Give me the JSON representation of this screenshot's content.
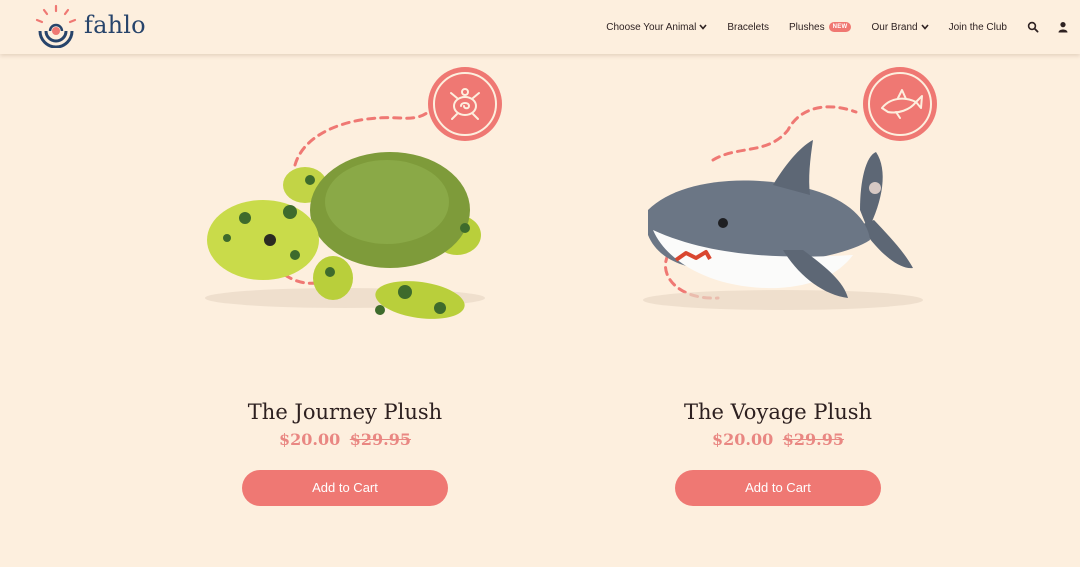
{
  "brand": {
    "name": "fahlo"
  },
  "nav": {
    "items": [
      {
        "label": "Choose Your Animal",
        "dropdown": true
      },
      {
        "label": "Bracelets",
        "dropdown": false
      },
      {
        "label": "Plushes",
        "badge": "NEW"
      },
      {
        "label": "Our Brand",
        "dropdown": true
      },
      {
        "label": "Join the Club",
        "dropdown": false
      }
    ],
    "search_icon": "search-icon",
    "account_icon": "user-icon"
  },
  "colors": {
    "background": "#fdefde",
    "accent": "#ef7873",
    "brand_navy": "#27446b",
    "price": "#e98782"
  },
  "products": [
    {
      "title": "The Journey Plush",
      "price": "$20.00",
      "original_price": "$29.95",
      "button": "Add to Cart",
      "animal_icon": "turtle-icon"
    },
    {
      "title": "The Voyage Plush",
      "price": "$20.00",
      "original_price": "$29.95",
      "button": "Add to Cart",
      "animal_icon": "shark-icon"
    }
  ]
}
